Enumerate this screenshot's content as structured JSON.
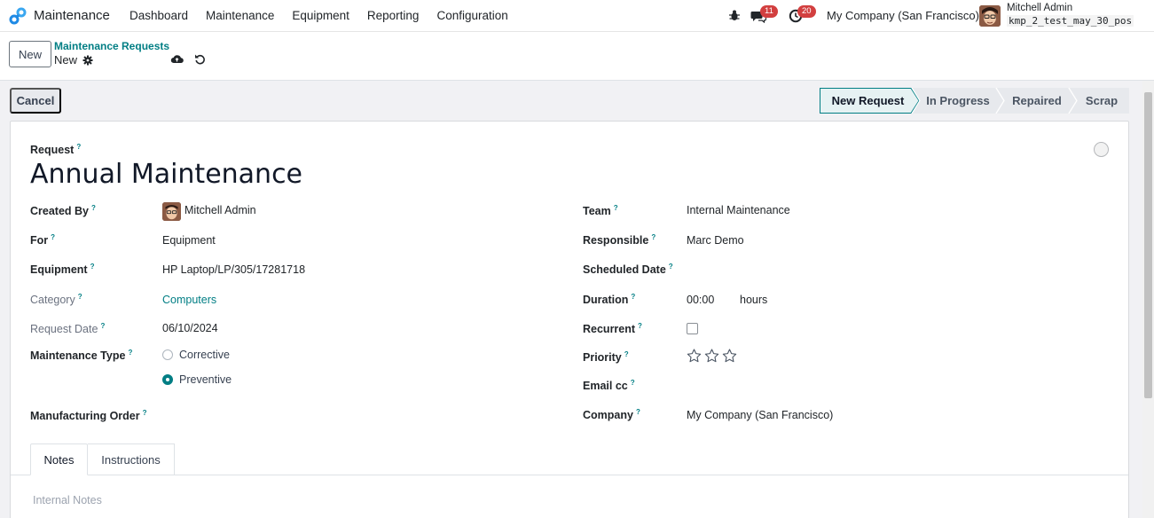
{
  "navbar": {
    "app_name": "Maintenance",
    "menu": [
      "Dashboard",
      "Maintenance",
      "Equipment",
      "Reporting",
      "Configuration"
    ],
    "messages_count": "11",
    "activities_count": "20",
    "company": "My Company (San Francisco)",
    "user_name": "Mitchell Admin",
    "database": "kmp_2_test_may_30_pos"
  },
  "control": {
    "new_label": "New",
    "breadcrumb_parent": "Maintenance Requests",
    "breadcrumb_current": "New"
  },
  "actions": {
    "cancel_label": "Cancel"
  },
  "statusbar": {
    "stages": [
      "New Request",
      "In Progress",
      "Repaired",
      "Scrap"
    ],
    "active_index": 0
  },
  "form": {
    "request_label": "Request",
    "title": "Annual Maintenance",
    "left": {
      "created_by_label": "Created By",
      "created_by_value": "Mitchell Admin",
      "for_label": "For",
      "for_value": "Equipment",
      "equipment_label": "Equipment",
      "equipment_value": "HP Laptop/LP/305/17281718",
      "category_label": "Category",
      "category_value": "Computers",
      "request_date_label": "Request Date",
      "request_date_value": "06/10/2024",
      "maintenance_type_label": "Maintenance Type",
      "type_options": [
        "Corrective",
        "Preventive"
      ],
      "type_selected": "Preventive",
      "manufacturing_order_label": "Manufacturing Order"
    },
    "right": {
      "team_label": "Team",
      "team_value": "Internal Maintenance",
      "responsible_label": "Responsible",
      "responsible_value": "Marc Demo",
      "scheduled_date_label": "Scheduled Date",
      "duration_label": "Duration",
      "duration_value": "00:00",
      "duration_unit": "hours",
      "recurrent_label": "Recurrent",
      "recurrent_checked": false,
      "priority_label": "Priority",
      "priority_stars": 0,
      "email_cc_label": "Email cc",
      "company_label": "Company",
      "company_value": "My Company (San Francisco)"
    },
    "help_mark": "?"
  },
  "tabs": {
    "items": [
      "Notes",
      "Instructions"
    ],
    "active": "Notes",
    "notes_placeholder": "Internal Notes"
  },
  "colors": {
    "accent": "#017e84",
    "badge": "#d23f3f"
  }
}
